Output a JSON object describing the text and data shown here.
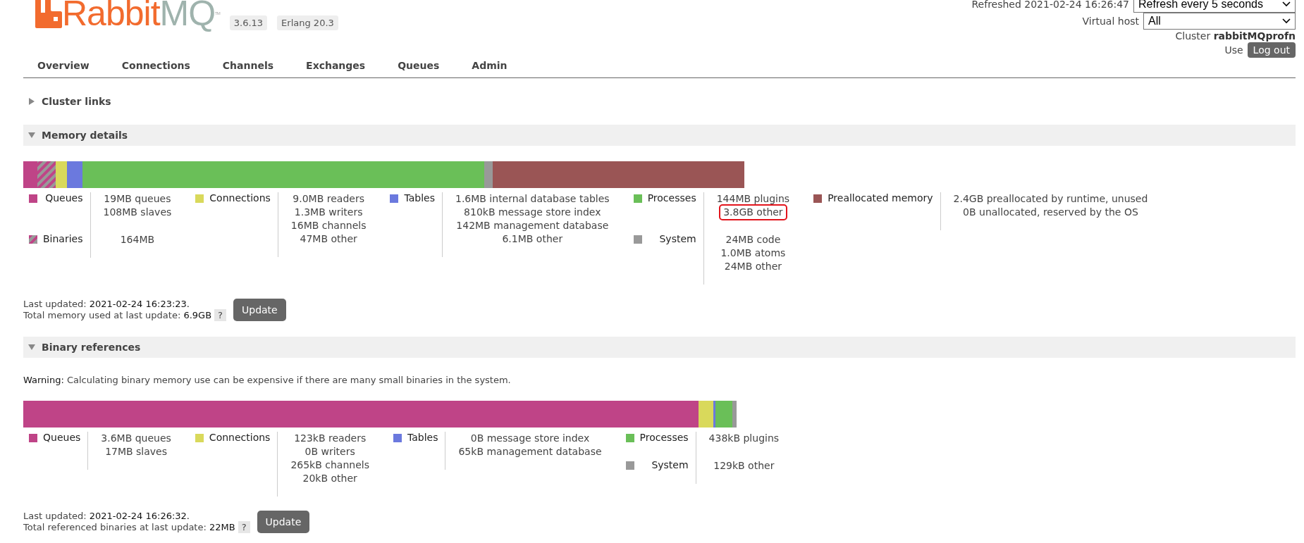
{
  "logo": {
    "word_1": "Rabbit",
    "word_2": "MQ",
    "tm": "TM"
  },
  "badges": [
    "3.6.13",
    "Erlang 20.3"
  ],
  "nav": [
    {
      "label": "Overview",
      "selected": false
    },
    {
      "label": "Connections",
      "selected": false
    },
    {
      "label": "Channels",
      "selected": false
    },
    {
      "label": "Exchanges",
      "selected": false
    },
    {
      "label": "Queues",
      "selected": false
    },
    {
      "label": "Admin",
      "selected": false
    }
  ],
  "header_right": {
    "refreshed": "Refreshed 2021-02-24 16:26:47",
    "refresh_select": "Refresh every 5 seconds",
    "vhost_label": "Virtual host",
    "vhost_select": "All",
    "cluster_label": "Cluster",
    "cluster_name": "rabbitMQprofn",
    "user_label": "Use",
    "logout": "Log out"
  },
  "cluster_links": {
    "title": "Cluster links",
    "expanded": false
  },
  "sections": [
    {
      "title": "Memory details",
      "expanded": true,
      "groups": [
        [
          {
            "label": "Queues",
            "color": "#bf4487",
            "kind": "solid",
            "values": [
              {
                "text": "19MB queues",
                "highlighted": false
              },
              {
                "text": "108MB slaves",
                "highlighted": false
              }
            ]
          },
          {
            "label": "Binaries",
            "color": "#bf4487",
            "kind": "hatched",
            "values": [
              {
                "text": "164MB",
                "highlighted": false
              }
            ]
          }
        ],
        [
          {
            "label": "Connections",
            "color": "#d9d95b",
            "kind": "solid",
            "values": [
              {
                "text": "9.0MB readers",
                "highlighted": false
              },
              {
                "text": "1.3MB writers",
                "highlighted": false
              },
              {
                "text": "16MB channels",
                "highlighted": false
              },
              {
                "text": "47MB other",
                "highlighted": false
              }
            ]
          }
        ],
        [
          {
            "label": "Tables",
            "color": "#6b79de",
            "kind": "solid",
            "values": [
              {
                "text": "1.6MB internal database tables",
                "highlighted": false
              },
              {
                "text": "810kB message store index",
                "highlighted": false
              },
              {
                "text": "142MB management database",
                "highlighted": false
              },
              {
                "text": "6.1MB other",
                "highlighted": false
              }
            ]
          }
        ],
        [
          {
            "label": "Processes",
            "color": "#6abf58",
            "kind": "solid",
            "values": [
              {
                "text": "144MB plugins",
                "highlighted": false
              },
              {
                "text": "3.8GB other",
                "highlighted": true
              }
            ]
          },
          {
            "label": "System",
            "color": "#999999",
            "kind": "solid",
            "values": [
              {
                "text": "24MB code",
                "highlighted": false
              },
              {
                "text": "1.0MB atoms",
                "highlighted": false
              },
              {
                "text": "24MB other",
                "highlighted": false
              }
            ]
          }
        ],
        [
          {
            "label": "Preallocated memory",
            "color": "#9a5555",
            "kind": "solid",
            "values": [
              {
                "text": "2.4GB preallocated by runtime, unused",
                "highlighted": false
              },
              {
                "text": "0B unallocated, reserved by the OS",
                "highlighted": false
              }
            ]
          }
        ]
      ],
      "updated_label": "Last updated:",
      "updated": "2021-02-24 16:23:23.",
      "total_label": "Total memory used at last update:",
      "total": "6.9GB",
      "help": "?",
      "button": "Update"
    },
    {
      "title": "Binary references",
      "expanded": true,
      "warning_label": "Warning:",
      "warning": "Calculating binary memory use can be expensive if there are many small binaries in the system.",
      "groups": [
        [
          {
            "label": "Queues",
            "color": "#bf4487",
            "kind": "solid",
            "values": [
              {
                "text": "3.6MB queues",
                "highlighted": false
              },
              {
                "text": "17MB slaves",
                "highlighted": false
              }
            ]
          }
        ],
        [
          {
            "label": "Connections",
            "color": "#d9d95b",
            "kind": "solid",
            "values": [
              {
                "text": "123kB readers",
                "highlighted": false
              },
              {
                "text": "0B writers",
                "highlighted": false
              },
              {
                "text": "265kB channels",
                "highlighted": false
              },
              {
                "text": "20kB other",
                "highlighted": false
              }
            ]
          }
        ],
        [
          {
            "label": "Tables",
            "color": "#6b79de",
            "kind": "solid",
            "values": [
              {
                "text": "0B message store index",
                "highlighted": false
              },
              {
                "text": "65kB management database",
                "highlighted": false
              }
            ]
          }
        ],
        [
          {
            "label": "Processes",
            "color": "#6abf58",
            "kind": "solid",
            "values": [
              {
                "text": "438kB plugins",
                "highlighted": false
              }
            ]
          },
          {
            "label": "System",
            "color": "#999999",
            "kind": "solid",
            "values": [
              {
                "text": "129kB other",
                "highlighted": false
              }
            ]
          }
        ]
      ],
      "updated_label": "Last updated:",
      "updated": "2021-02-24 16:26:32.",
      "total_label": "Total referenced binaries at last update:",
      "total": "22MB",
      "help": "?",
      "button": "Update"
    }
  ]
}
